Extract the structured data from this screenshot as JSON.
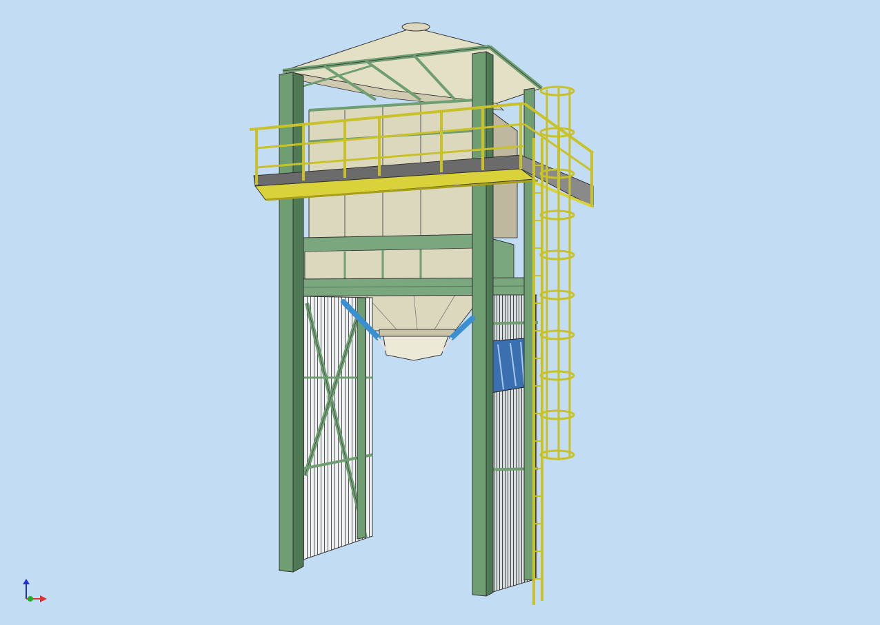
{
  "viewport": {
    "background": "#c2dcf3",
    "model": "steel-silo-structure-with-cage-ladder"
  },
  "colors": {
    "frame_green": "#6e9e72",
    "frame_green_dark": "#4f7a55",
    "railing_yellow": "#d9d23a",
    "railing_yellow_dark": "#a89e1a",
    "hopper_beige": "#dcd8be",
    "hopper_beige_dark": "#b9b49a",
    "grating_dark": "#6b6b6b",
    "cylinder_blue": "#3a8fd0",
    "cladding_light": "#e8ebee",
    "axis_x": "#e03030",
    "axis_y": "#20b020",
    "axis_z": "#2030d0"
  },
  "icons": [
    "axis-triad-icon"
  ]
}
